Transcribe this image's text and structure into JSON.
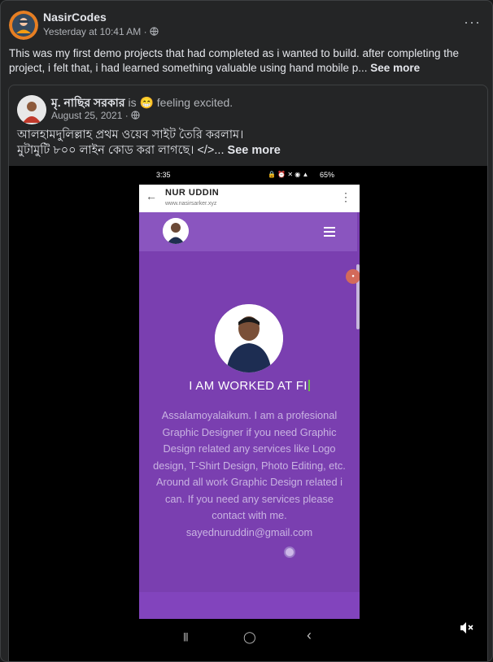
{
  "post": {
    "author": "NasirCodes",
    "timestamp": "Yesterday at 10:41 AM",
    "separator": "·",
    "privacy_icon": "globe-icon",
    "more_label": "···",
    "text": "This was my first demo projects that had completed as i wanted to build. after completing the project, i felt that, i had learned something valuable using hand mobile p...",
    "see_more": "See more"
  },
  "shared": {
    "author": "মৃ. নাছির সরকার",
    "is_text": "is",
    "feeling_emoji": "😁",
    "feeling": "feeling excited.",
    "date": "August 25, 2021",
    "separator": "·",
    "privacy_icon": "globe-icon",
    "line1": "আলহামদুলিল্লাহ প্রথম ওয়েব সাইট তৈরি করলাম।",
    "line2": "মুটামুটি ৮০০ লাইন কোড করা লাগছে। </>...",
    "see_more": "See more"
  },
  "video": {
    "status_time": "3:35",
    "status_right": "65%",
    "browser": {
      "title": "NUR UDDIN",
      "url": "www.nasirsarker.xyz",
      "back": "←",
      "menu": "⋮"
    },
    "site": {
      "hero_title": "I AM WORKED AT FI",
      "hero_desc": "Assalamoyalaikum. I am a profesional Graphic Designer if you need Graphic Design related any services like Logo design, T-Shirt Design, Photo Editing, etc. Around all work Graphic Design related i can. If you need any services please contact with me.",
      "email": "sayednuruddin@gmail.com"
    },
    "phone_nav": {
      "recent": "|||",
      "home": "◯",
      "back": "‹"
    },
    "mute_icon": "speaker-muted-icon"
  },
  "colors": {
    "background": "#18191a",
    "card": "#242526",
    "site_purple": "#7a3fb0",
    "nav_purple": "#8a55bf"
  }
}
